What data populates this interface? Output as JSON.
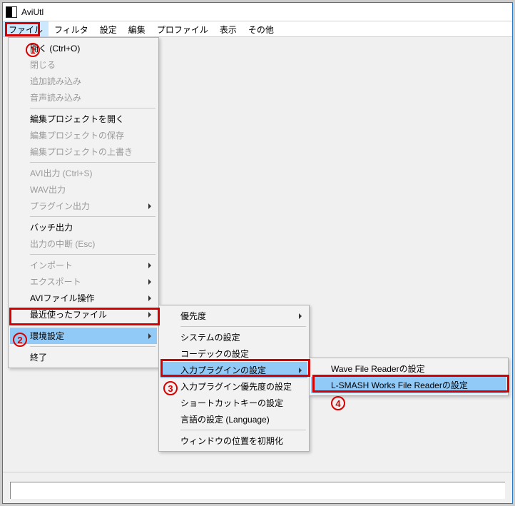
{
  "window": {
    "title": "AviUtl"
  },
  "menubar": {
    "items": [
      {
        "label": "ファイル",
        "active": true
      },
      {
        "label": "フィルタ"
      },
      {
        "label": "設定"
      },
      {
        "label": "編集"
      },
      {
        "label": "プロファイル"
      },
      {
        "label": "表示"
      },
      {
        "label": "その他"
      }
    ]
  },
  "menu_file": {
    "groups": [
      [
        {
          "label": "開く (Ctrl+O)",
          "enabled": true
        },
        {
          "label": "閉じる",
          "enabled": false
        },
        {
          "label": "追加読み込み",
          "enabled": false
        },
        {
          "label": "音声読み込み",
          "enabled": false
        }
      ],
      [
        {
          "label": "編集プロジェクトを開く",
          "enabled": true
        },
        {
          "label": "編集プロジェクトの保存",
          "enabled": false
        },
        {
          "label": "編集プロジェクトの上書き",
          "enabled": false
        }
      ],
      [
        {
          "label": "AVI出力 (Ctrl+S)",
          "enabled": false
        },
        {
          "label": "WAV出力",
          "enabled": false
        },
        {
          "label": "プラグイン出力",
          "enabled": false,
          "submenu": true
        }
      ],
      [
        {
          "label": "バッチ出力",
          "enabled": true
        },
        {
          "label": "出力の中断 (Esc)",
          "enabled": false
        }
      ],
      [
        {
          "label": "インポート",
          "enabled": false,
          "submenu": true
        },
        {
          "label": "エクスポート",
          "enabled": false,
          "submenu": true
        },
        {
          "label": "AVIファイル操作",
          "enabled": true,
          "submenu": true
        },
        {
          "label": "最近使ったファイル",
          "enabled": true,
          "submenu": true
        }
      ],
      [
        {
          "label": "環境設定",
          "enabled": true,
          "submenu": true,
          "highlight": true
        }
      ],
      [
        {
          "label": "終了",
          "enabled": true
        }
      ]
    ]
  },
  "menu_env": {
    "groups": [
      [
        {
          "label": "優先度",
          "enabled": true,
          "submenu": true
        }
      ],
      [
        {
          "label": "システムの設定",
          "enabled": true
        },
        {
          "label": "コーデックの設定",
          "enabled": true
        },
        {
          "label": "入力プラグインの設定",
          "enabled": true,
          "submenu": true,
          "highlight": true
        },
        {
          "label": "入力プラグイン優先度の設定",
          "enabled": true
        },
        {
          "label": "ショートカットキーの設定",
          "enabled": true
        },
        {
          "label": "言語の設定 (Language)",
          "enabled": true
        }
      ],
      [
        {
          "label": "ウィンドウの位置を初期化",
          "enabled": true
        }
      ]
    ]
  },
  "menu_input_plugin": {
    "groups": [
      [
        {
          "label": "Wave File Readerの設定",
          "enabled": true
        },
        {
          "label": "L-SMASH Works File Readerの設定",
          "enabled": true,
          "highlight": true
        }
      ]
    ]
  },
  "annotations": {
    "n1": "1",
    "n2": "2",
    "n3": "3",
    "n4": "4"
  }
}
